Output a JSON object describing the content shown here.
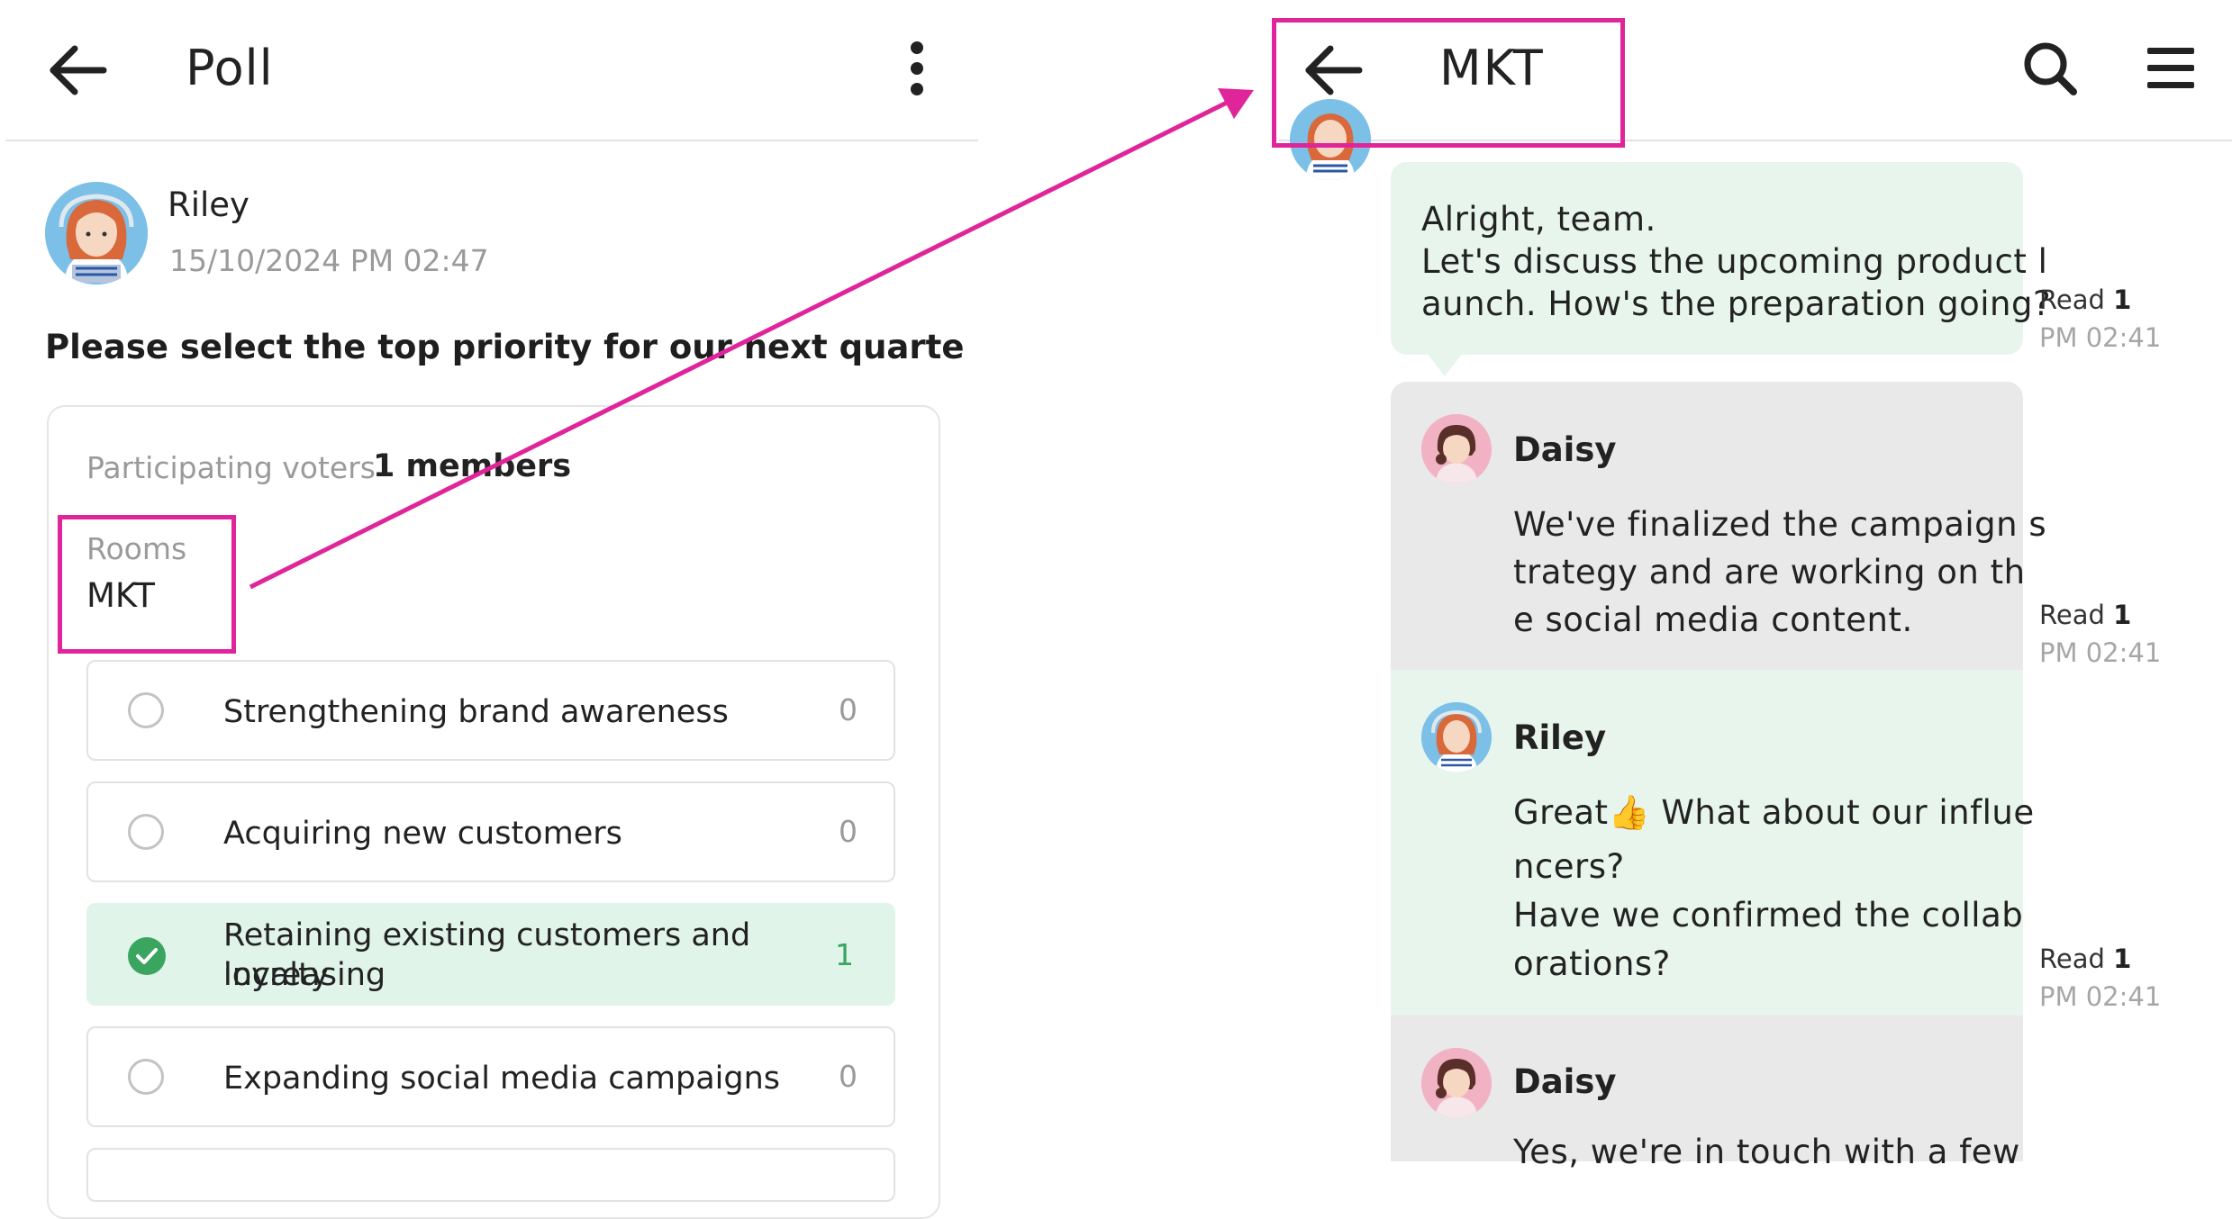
{
  "poll": {
    "title": "Poll",
    "author": {
      "name": "Riley",
      "timestamp": "15/10/2024 PM 02:47"
    },
    "question": "Please select the top priority for our next quarte",
    "voters_label": "Participating voters",
    "voters_value": "1 members",
    "rooms_label": "Rooms",
    "rooms_value": "MKT",
    "options": [
      {
        "label": "Strengthening brand awareness",
        "count": "0",
        "selected": false
      },
      {
        "label": "Acquiring new customers",
        "count": "0",
        "selected": false
      },
      {
        "label_line1": "Retaining existing customers and increasing",
        "label_line2": "loyalty",
        "count": "1",
        "selected": true
      },
      {
        "label": "Expanding social media campaigns",
        "count": "0",
        "selected": false
      }
    ]
  },
  "chat": {
    "title": "MKT",
    "messages": [
      {
        "lines": [
          "Alright, team.",
          "Let's discuss the upcoming product l",
          "aunch. How's the preparation going?"
        ],
        "read_label": "Read",
        "read_count": "1",
        "time": "PM 02:41"
      },
      {
        "sender": "Daisy",
        "lines": [
          "We've finalized the campaign s",
          "trategy and are working on th",
          "e social media content."
        ],
        "read_label": "Read",
        "read_count": "1",
        "time": "PM 02:41"
      },
      {
        "sender": "Riley",
        "lines": [
          "Great👍 What about our influe",
          "ncers?",
          "Have we confirmed the collab",
          "orations?"
        ],
        "read_label": "Read",
        "read_count": "1",
        "time": "PM 02:41"
      },
      {
        "sender": "Daisy",
        "lines": [
          "Yes, we're in touch with a few"
        ]
      }
    ]
  },
  "colors": {
    "annotation": "#e0249a",
    "selected_option_bg": "#e0f4ea",
    "check_green": "#3aa55f",
    "own_bubble_bg": "#e7f5ed",
    "other_bubble_bg": "#e9e9e9"
  },
  "icons": {
    "back": "arrow-left-icon",
    "more": "more-vertical-icon",
    "search": "search-icon",
    "menu": "hamburger-menu-icon",
    "check": "check-circle-icon",
    "thumbs_up": "thumbs-up-emoji"
  }
}
